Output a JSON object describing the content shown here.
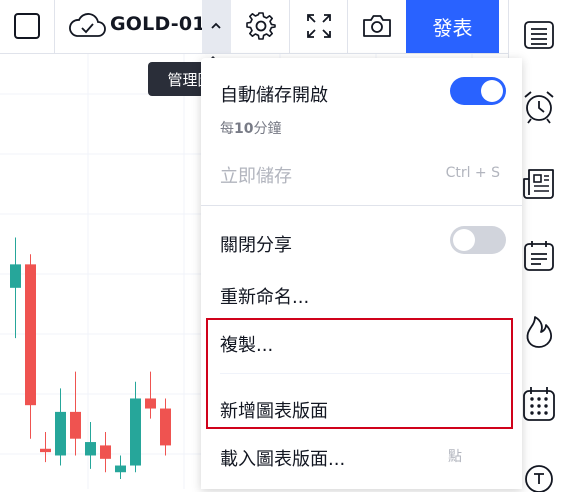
{
  "toolbar": {
    "layout_name": "GOLD-01",
    "publish_label": "發表",
    "accent": "#2962ff"
  },
  "tooltip": {
    "text": "管理圖表版面"
  },
  "menu": {
    "autosave": {
      "label": "自動儲存開啟",
      "sub_prefix": "每",
      "sub_number": "10",
      "sub_suffix": "分鐘",
      "enabled": true
    },
    "save_now": {
      "label": "立即儲存",
      "shortcut": "Ctrl + S"
    },
    "share": {
      "label": "關閉分享",
      "enabled": false
    },
    "rename": {
      "label": "重新命名..."
    },
    "copy": {
      "label": "複製..."
    },
    "new_layout": {
      "label": "新增圖表版面"
    },
    "load_layout": {
      "label": "載入圖表版面...",
      "shortcut": "點"
    }
  },
  "colors": {
    "up": "#26a69a",
    "down": "#ef5350",
    "toggle_on": "#2962ff",
    "toggle_off": "#d1d4dc",
    "highlight_border": "#d0021b"
  },
  "icons": {
    "sidebar": [
      "watchlist-icon",
      "alarm-clock-icon",
      "news-icon",
      "calendar-list-icon",
      "flame-icon",
      "calendar-grid-icon",
      "ideas-icon"
    ]
  },
  "chart_data": {
    "type": "candlestick",
    "candles": [
      {
        "open": 0.55,
        "close": 0.62,
        "high": 0.7,
        "low": 0.4
      },
      {
        "open": 0.62,
        "close": 0.2,
        "high": 0.65,
        "low": 0.1
      },
      {
        "open": 0.07,
        "close": 0.06,
        "high": 0.12,
        "low": 0.03
      },
      {
        "open": 0.05,
        "close": 0.18,
        "high": 0.25,
        "low": 0.02
      },
      {
        "open": 0.18,
        "close": 0.1,
        "high": 0.3,
        "low": 0.05
      },
      {
        "open": 0.05,
        "close": 0.09,
        "high": 0.15,
        "low": 0.01
      },
      {
        "open": 0.08,
        "close": 0.04,
        "high": 0.12,
        "low": 0.0
      },
      {
        "open": 0.0,
        "close": 0.02,
        "high": 0.05,
        "low": -0.02
      },
      {
        "open": 0.02,
        "close": 0.22,
        "high": 0.27,
        "low": 0.0
      },
      {
        "open": 0.22,
        "close": 0.19,
        "high": 0.3,
        "low": 0.16
      },
      {
        "open": 0.19,
        "close": 0.08,
        "high": 0.22,
        "low": 0.05
      }
    ]
  }
}
